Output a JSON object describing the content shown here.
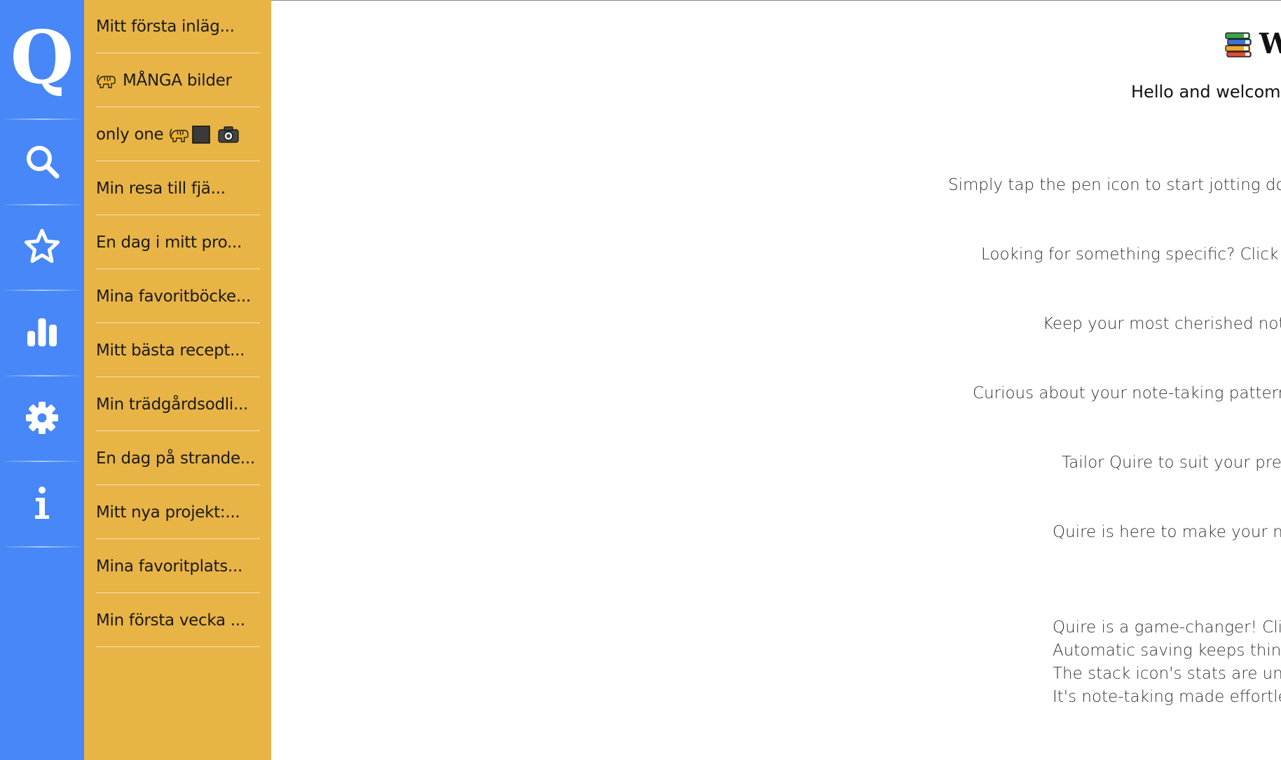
{
  "rail": {
    "logo": "Q",
    "buttons": [
      "search-icon",
      "star-icon",
      "bar-chart-icon",
      "gear-icon",
      "info-icon"
    ]
  },
  "notes": [
    {
      "label": "Mitt första inläg..."
    },
    {
      "label": "MÅNGA bilder",
      "icons": [
        "tiger-icon"
      ]
    },
    {
      "label": "only one",
      "icons_after": [
        "tiger-icon",
        "black-square-icon",
        "camera-icon"
      ]
    },
    {
      "label": "Min resa till fjä..."
    },
    {
      "label": "En dag i mitt pro..."
    },
    {
      "label": "Mina favoritböcke..."
    },
    {
      "label": "Mitt bästa recept..."
    },
    {
      "label": "Min trädgårdsodli..."
    },
    {
      "label": "En dag på strande..."
    },
    {
      "label": "Mitt nya projekt:..."
    },
    {
      "label": "Mina favoritplats..."
    },
    {
      "label": "Min första vecka ..."
    }
  ],
  "main": {
    "title_icon": "books-icon",
    "title": "W",
    "hello": "Hello and welcome t",
    "lines": [
      "Simply tap the pen icon to start jotting dow",
      "Looking for something specific? Click on",
      "Keep your most cherished note",
      "Curious about your note-taking patterns",
      "Tailor Quire to suit your prefe",
      "Quire is here to make your not"
    ],
    "footer_lines": [
      "Quire is a game-changer! Click",
      "Automatic saving keeps things",
      "The stack icon's stats are unex",
      "It's note-taking made effortles"
    ]
  },
  "colors": {
    "rail": "#4787f7",
    "notes_panel": "#e8b445",
    "main_bg": "#ffffff"
  }
}
